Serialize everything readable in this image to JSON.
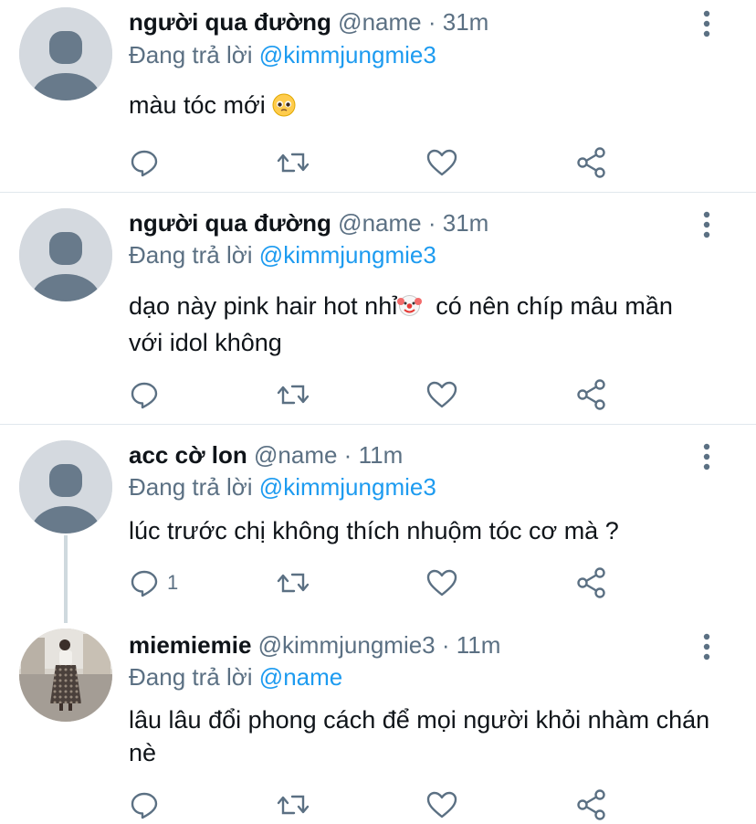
{
  "colors": {
    "accent": "#1d9bf0",
    "muted": "#5b7083",
    "text": "#0f1419",
    "divider": "#e1e8ed"
  },
  "icons": {
    "reply": "reply-icon",
    "retweet": "retweet-icon",
    "like": "heart-icon",
    "share": "share-icon",
    "more": "more-vertical-icon"
  },
  "tweets": [
    {
      "name": "người qua đường",
      "handle": "@name",
      "sep": "·",
      "time": "31m",
      "reply_prefix": "Đang trả lời",
      "reply_to": "@kimmjungmie3",
      "text": "màu tóc mới",
      "emoji": "pleading-face-emoji",
      "reply_count": ""
    },
    {
      "name": "người qua đường",
      "handle": "@name",
      "sep": "·",
      "time": "31m",
      "reply_prefix": "Đang trả lời",
      "reply_to": "@kimmjungmie3",
      "text_a": "dạo này pink hair hot nhỉ",
      "emoji": "clown-face-emoji",
      "text_b": "  có nên chíp mâu mần với idol không",
      "reply_count": ""
    },
    {
      "name": "acc cờ lon",
      "handle": "@name",
      "sep": "·",
      "time": "11m",
      "reply_prefix": "Đang trả lời",
      "reply_to": "@kimmjungmie3",
      "text": "lúc trước chị không thích nhuộm tóc cơ mà ?",
      "reply_count": "1"
    },
    {
      "name": "miemiemie",
      "handle": "@kimmjungmie3",
      "sep": "·",
      "time": "11m",
      "reply_prefix": "Đang trả lời",
      "reply_to": "@name",
      "text": "lâu lâu đổi phong cách để mọi người khỏi nhàm chán nè",
      "reply_count": ""
    }
  ]
}
